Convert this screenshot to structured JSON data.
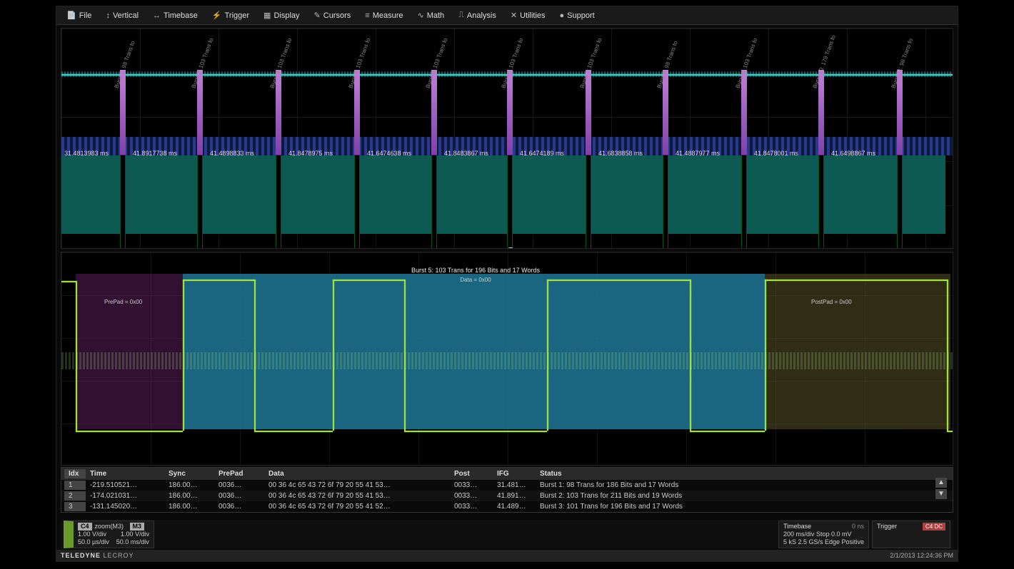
{
  "menu": {
    "items": [
      {
        "icon": "📄",
        "label": "File"
      },
      {
        "icon": "↕",
        "label": "Vertical"
      },
      {
        "icon": "↔",
        "label": "Timebase"
      },
      {
        "icon": "⚡",
        "label": "Trigger"
      },
      {
        "icon": "▦",
        "label": "Display"
      },
      {
        "icon": "✎",
        "label": "Cursors"
      },
      {
        "icon": "≡",
        "label": "Measure"
      },
      {
        "icon": "∿",
        "label": "Math"
      },
      {
        "icon": "⎍",
        "label": "Analysis"
      },
      {
        "icon": "✕",
        "label": "Utilities"
      },
      {
        "icon": "●",
        "label": "Support"
      }
    ]
  },
  "top_panel": {
    "bursts": [
      {
        "label": "Burst 1: 98 Trans fo",
        "time": "31.4813983 ms"
      },
      {
        "label": "Burst 2: 103 Trans fo",
        "time": "41.8917738 ms"
      },
      {
        "label": "Burst 3: 103 Trans fo",
        "time": "41.4898833 ms"
      },
      {
        "label": "Burst 4: 103 Trans fo",
        "time": "41.8478975 ms"
      },
      {
        "label": "Burst 5: 103 Trans fo",
        "time": "41.6474638 ms"
      },
      {
        "label": "Burst 6: 103 Trans fo",
        "time": "41.8483867 ms"
      },
      {
        "label": "Burst 7: 103 Trans fo",
        "time": "41.6474189 ms"
      },
      {
        "label": "Burst 8: 98 Trans fo",
        "time": "41.6838858 ms"
      },
      {
        "label": "Burst 9: 103 Trans fo",
        "time": "41.4887977 ms"
      },
      {
        "label": "Burst 10: 179 Trans fo",
        "time": "41.8478001 ms"
      },
      {
        "label": "Burst 11: 98 Trans fo",
        "time": "41.6498867 ms"
      }
    ]
  },
  "zoom_panel": {
    "title": "Burst 5: 103 Trans for 196 Bits and 17 Words",
    "subtitle": "Data = 0x00",
    "prepad_label": "PrePad = 0x00",
    "postpad_label": "PostPad = 0x00"
  },
  "table": {
    "headers": {
      "idx": "Idx",
      "time": "Time",
      "sync": "Sync",
      "prepad": "PrePad",
      "data": "Data",
      "post": "Post",
      "ifg": "IFG",
      "status": "Status"
    },
    "rows": [
      {
        "idx": "1",
        "time": "-219.510521…",
        "sync": "186.00…",
        "prepad": "0036…",
        "data": "00 36 4c 65 43 72 6f 79 20 55 41 53…",
        "post": "0033…",
        "ifg": "31.481…",
        "status": "Burst 1: 98 Trans for 186 Bits and 17 Words"
      },
      {
        "idx": "2",
        "time": "-174.021031…",
        "sync": "186.00…",
        "prepad": "0036…",
        "data": "00 36 4c 65 43 72 6f 79 20 55 41 53…",
        "post": "0033…",
        "ifg": "41.891…",
        "status": "Burst 2: 103 Trans for 211 Bits and 19 Words"
      },
      {
        "idx": "3",
        "time": "-131.145020…",
        "sync": "186.00…",
        "prepad": "0036…",
        "data": "00 36 4c 65 43 72 6f 79 20 55 41 52…",
        "post": "0033…",
        "ifg": "41.489…",
        "status": "Burst 3: 101 Trans for 196 Bits and 17 Words"
      }
    ]
  },
  "channels": {
    "c4": {
      "tag": "C4",
      "name": "zoom(M3)",
      "line1": "1.00 V/div",
      "line2": "50.0 µs/div"
    },
    "m3": {
      "tag": "M3",
      "line1": "1.00 V/div",
      "line2": "50.0 ms/div"
    }
  },
  "timebase": {
    "title": "Timebase",
    "val": "0 ns",
    "l1": "200 ms/div  Stop  0.0 mV",
    "l2": "5 kS  2.5 GS/s  Edge  Positive"
  },
  "trigger": {
    "title": "Trigger",
    "flag": "C4 DC"
  },
  "status": {
    "brand_a": "TELEDYNE",
    "brand_b": "LECROY",
    "timestamp": "2/1/2013 12:24:36 PM"
  }
}
